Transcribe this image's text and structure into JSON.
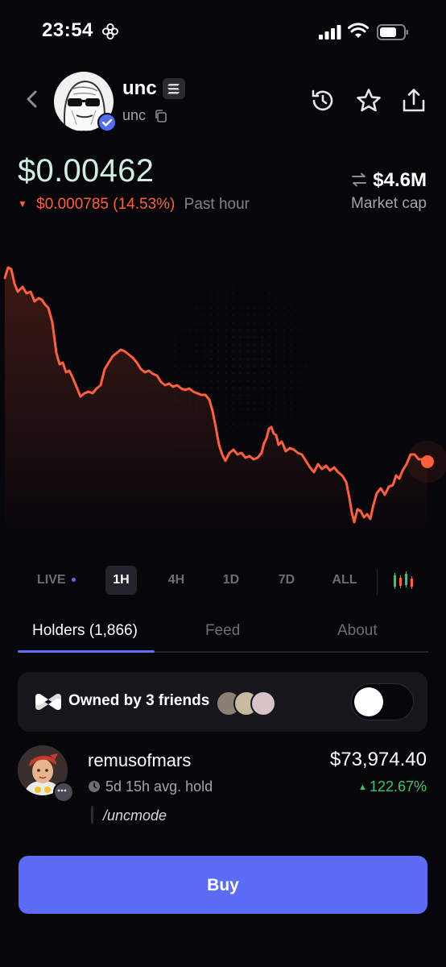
{
  "status_bar": {
    "time": "23:54"
  },
  "token": {
    "name": "unc",
    "ticker": "unc"
  },
  "price": {
    "value": "$0.00462",
    "change": "$0.000785 (14.53%)",
    "period": "Past hour",
    "market_cap": "$4.6M",
    "market_cap_label": "Market cap"
  },
  "timeframes": [
    "LIVE",
    "1H",
    "4H",
    "1D",
    "7D",
    "ALL"
  ],
  "active_timeframe": "1H",
  "tabs": [
    "Holders (1,866)",
    "Feed",
    "About"
  ],
  "friends": {
    "text": "Owned by 3 friends",
    "toggle_on": false
  },
  "holder": {
    "name": "remusofmars",
    "avg_hold": "5d 15h avg. hold",
    "value": "$73,974.40",
    "gain": "122.67%",
    "note": "/uncmode"
  },
  "buy_label": "Buy",
  "colors": {
    "accent": "#5c6cf6",
    "chart_line": "#ff5f3a",
    "positive": "#34c76b",
    "price": "#cfeee0"
  }
}
